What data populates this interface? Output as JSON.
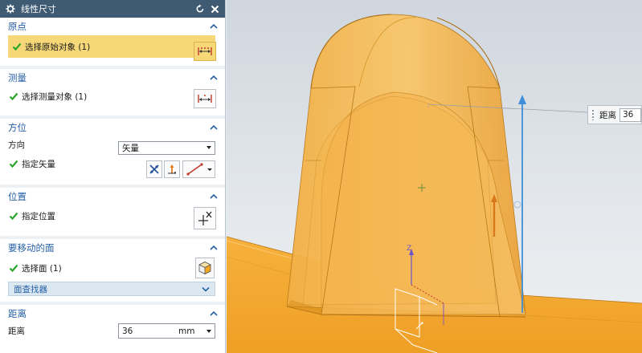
{
  "dialog": {
    "title": "线性尺寸",
    "sections": {
      "origin": {
        "label": "原点",
        "row_label": "选择原始对象 (1)"
      },
      "measure": {
        "label": "测量",
        "row_label": "选择测量对象 (1)"
      },
      "orientation": {
        "label": "方位",
        "direction_label": "方向",
        "direction_value": "矢量",
        "vector_label": "指定矢量"
      },
      "position": {
        "label": "位置",
        "row_label": "指定位置"
      },
      "faces_to_move": {
        "label": "要移动的面",
        "row_label": "选择面 (1)",
        "finder_label": "面查找器"
      },
      "distance": {
        "label": "距离",
        "field_label": "距离",
        "value": "36",
        "unit": "mm"
      }
    }
  },
  "viewport": {
    "distance_label": "距离",
    "distance_value": "36",
    "axis_z_label": "Z"
  },
  "colors": {
    "accent": "#2660a6",
    "titlebar": "#3f5a73",
    "highlight": "#f7d879",
    "check": "#2aa52a",
    "part": "#f5a623"
  }
}
